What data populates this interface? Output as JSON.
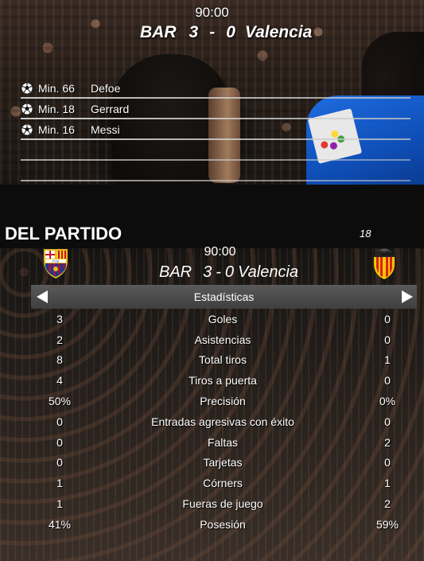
{
  "top": {
    "clock": "90:00",
    "score": {
      "home_team": "BAR",
      "home_goals": "3",
      "separator": "-",
      "away_goals": "0",
      "away_team": "Valencia"
    },
    "scorers": [
      {
        "minute": "Min. 66",
        "player": "Defoe"
      },
      {
        "minute": "Min. 18",
        "player": "Gerrard"
      },
      {
        "minute": "Min. 16",
        "player": "Messi"
      }
    ]
  },
  "bottom": {
    "title": "DEL PARTIDO",
    "page_number": "18",
    "clock": "90:00",
    "score": {
      "home_team": "BAR",
      "home_goals": "3",
      "separator": "-",
      "away_goals": "0",
      "away_team": "Valencia"
    },
    "home_crest_text": "FCB",
    "tab_label": "Estadísticas",
    "stats": [
      {
        "label": "Goles",
        "home": "3",
        "away": "0"
      },
      {
        "label": "Asistencias",
        "home": "2",
        "away": "0"
      },
      {
        "label": "Total tiros",
        "home": "8",
        "away": "1"
      },
      {
        "label": "Tiros a puerta",
        "home": "4",
        "away": "0"
      },
      {
        "label": "Precisión",
        "home": "50%",
        "away": "0%"
      },
      {
        "label": "Entradas agresivas con éxito",
        "home": "0",
        "away": "0"
      },
      {
        "label": "Faltas",
        "home": "0",
        "away": "2"
      },
      {
        "label": "Tarjetas",
        "home": "0",
        "away": "0"
      },
      {
        "label": "Córners",
        "home": "1",
        "away": "1"
      },
      {
        "label": "Fueras de juego",
        "home": "1",
        "away": "2"
      },
      {
        "label": "Posesión",
        "home": "41%",
        "away": "59%"
      }
    ]
  },
  "colors": {
    "tab_bar": "#4a4a4a",
    "barca_blue": "#1a3a8c",
    "barca_red": "#a3123a",
    "valencia_orange": "#f28c00",
    "player_shirt": "#1f6ce0"
  },
  "icons": [
    "football-icon",
    "left-arrow-icon",
    "right-arrow-icon",
    "fc-barcelona-crest",
    "valencia-crest"
  ]
}
